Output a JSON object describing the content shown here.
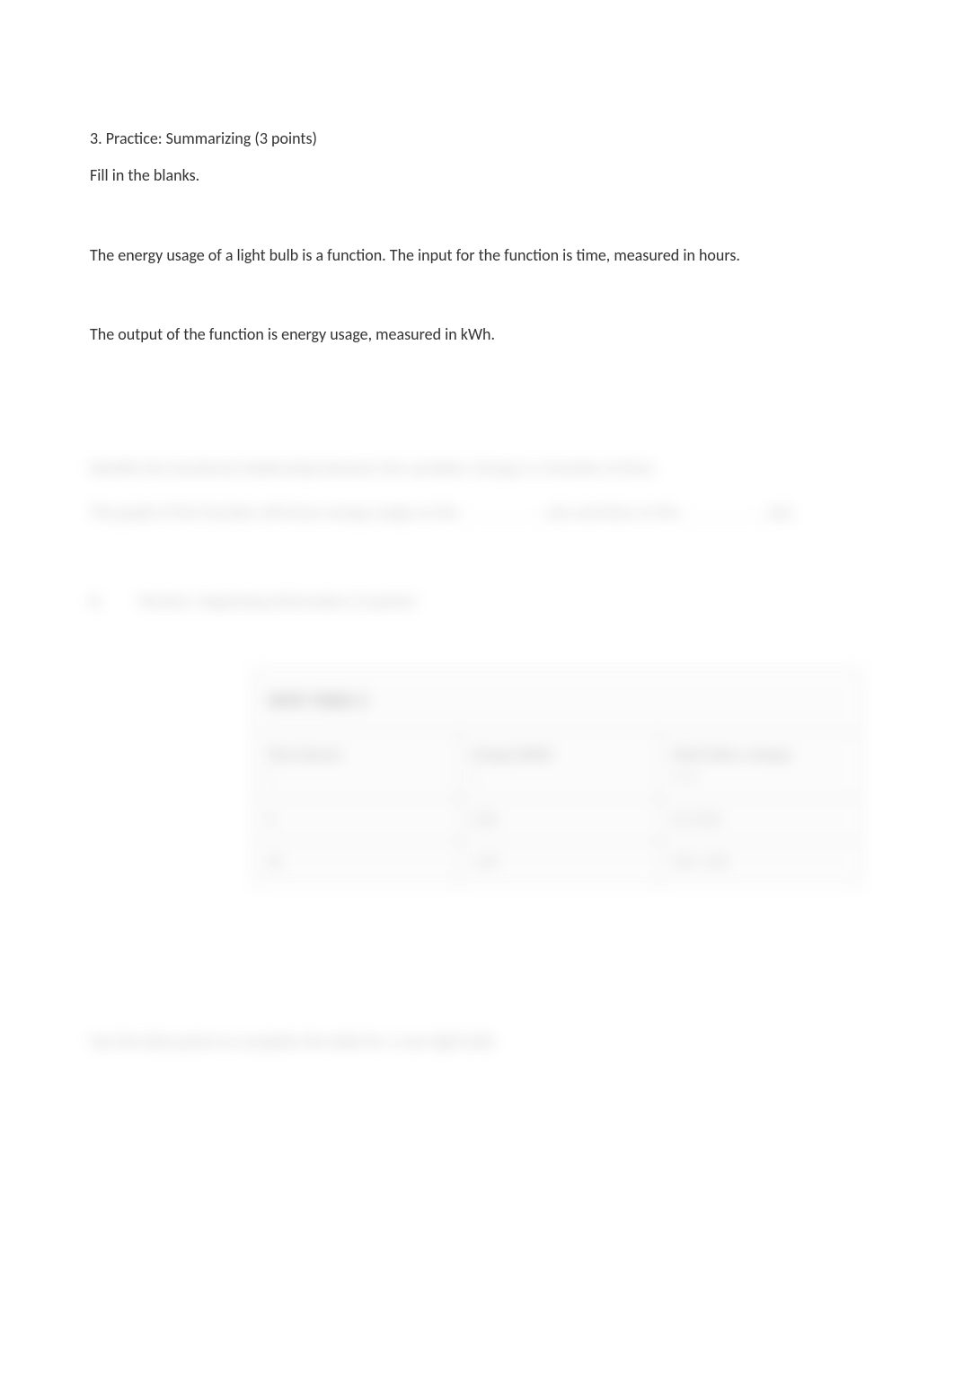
{
  "q3": {
    "heading": "3. Practice: Summarizing (3 points)",
    "instruction": "Fill in the blanks.",
    "p1": "The energy usage of a light bulb is a function. The input for the function is time, measured in hours.",
    "p2": "The output of the function is energy usage, measured in kWh."
  },
  "blurred": {
    "b1": "Identify the functional relationship between the variables. Energy is a function of time.",
    "b2_pre": "The graph of the function will show energy usage on the ",
    "b2_mid": " axis and time on the ",
    "b2_post": " axis."
  },
  "q4": {
    "num": "4.",
    "title": "Practice: Organizing Information (2 points)"
  },
  "table": {
    "title": "DATA TABLE 2",
    "headers": {
      "h1": "Time (hours)",
      "h1s": "x",
      "h2": "Energy (kWh)",
      "h2s": "y",
      "h3": "Point (time, energy)",
      "h3s": "(x, y)"
    },
    "rows": [
      {
        "c1": "0",
        "c2": "0.04",
        "c3": "(0, 0.04)"
      },
      {
        "c1": "10",
        "c2": "1.35",
        "c3": "(10, 1.35)"
      }
    ]
  },
  "closing": "Use the data points to complete the table for a new light bulb."
}
